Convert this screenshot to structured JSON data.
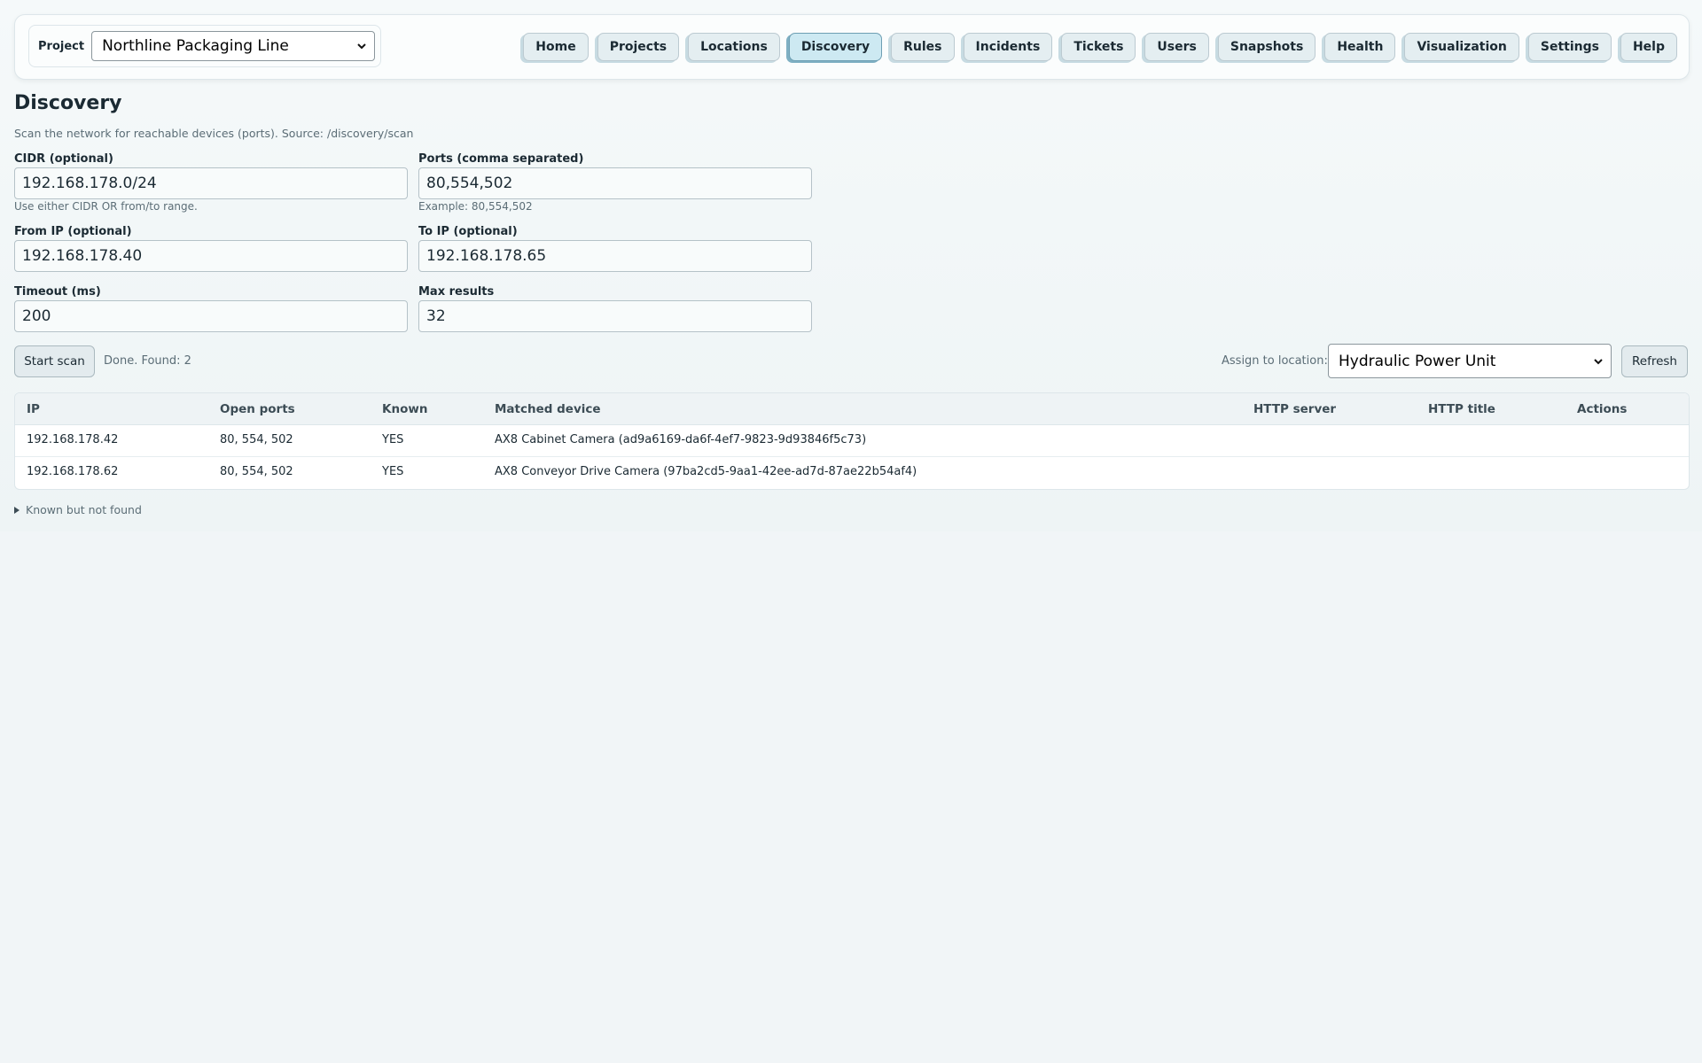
{
  "header": {
    "project_label": "Project",
    "project_selected": "Northline Packaging Line",
    "nav": [
      {
        "label": "Home",
        "active": false
      },
      {
        "label": "Projects",
        "active": false
      },
      {
        "label": "Locations",
        "active": false
      },
      {
        "label": "Discovery",
        "active": true
      },
      {
        "label": "Rules",
        "active": false
      },
      {
        "label": "Incidents",
        "active": false
      },
      {
        "label": "Tickets",
        "active": false
      },
      {
        "label": "Users",
        "active": false
      },
      {
        "label": "Snapshots",
        "active": false
      },
      {
        "label": "Health",
        "active": false
      },
      {
        "label": "Visualization",
        "active": false
      },
      {
        "label": "Settings",
        "active": false
      },
      {
        "label": "Help",
        "active": false
      }
    ]
  },
  "page": {
    "title": "Discovery",
    "subtitle": "Scan the network for reachable devices (ports). Source: /discovery/scan"
  },
  "form": {
    "cidr": {
      "label": "CIDR (optional)",
      "value": "192.168.178.0/24",
      "hint": "Use either CIDR OR from/to range."
    },
    "ports": {
      "label": "Ports (comma separated)",
      "value": "80,554,502",
      "hint": "Example: 80,554,502"
    },
    "from_ip": {
      "label": "From IP (optional)",
      "value": "192.168.178.40"
    },
    "to_ip": {
      "label": "To IP (optional)",
      "value": "192.168.178.65"
    },
    "timeout": {
      "label": "Timeout (ms)",
      "value": "200"
    },
    "max_results": {
      "label": "Max results",
      "value": "32"
    }
  },
  "actions": {
    "start_scan": "Start scan",
    "status": "Done. Found: 2",
    "assign_label": "Assign to location:",
    "assign_selected": "Hydraulic Power Unit",
    "refresh": "Refresh"
  },
  "table": {
    "columns": [
      "IP",
      "Open ports",
      "Known",
      "Matched device",
      "HTTP server",
      "HTTP title",
      "Actions"
    ],
    "rows": [
      {
        "ip": "192.168.178.42",
        "ports": "80, 554, 502",
        "known": "YES",
        "device": "AX8 Cabinet Camera (ad9a6169-da6f-4ef7-9823-9d93846f5c73)",
        "http_server": "",
        "http_title": "",
        "actions": ""
      },
      {
        "ip": "192.168.178.62",
        "ports": "80, 554, 502",
        "known": "YES",
        "device": "AX8 Conveyor Drive Camera (97ba2cd5-9aa1-42ee-ad7d-87ae22b54af4)",
        "http_server": "",
        "http_title": "",
        "actions": ""
      }
    ]
  },
  "details": {
    "summary": "Known but not found"
  },
  "icons": {
    "select_chevron": "chevron-down-icon",
    "details_toggle": "disclosure-triangle-icon"
  }
}
